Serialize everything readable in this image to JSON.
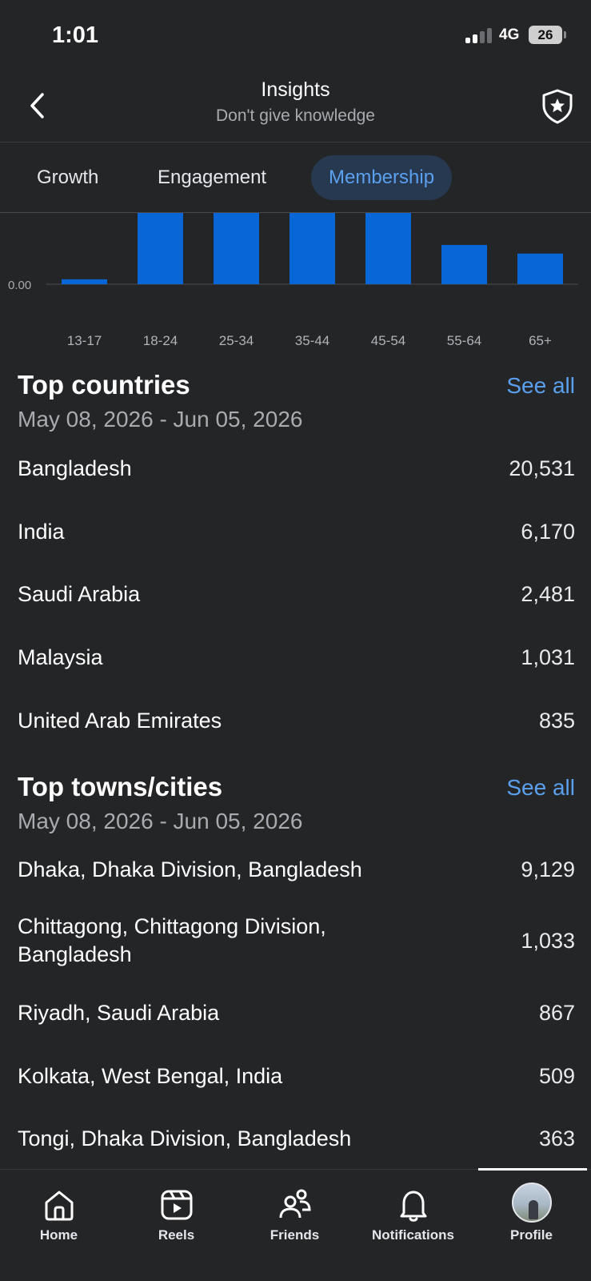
{
  "status_bar": {
    "time": "1:01",
    "network": "4G",
    "battery": "26"
  },
  "header": {
    "title": "Insights",
    "subtitle": "Don't give knowledge"
  },
  "tabs": [
    {
      "label": "Growth",
      "active": false
    },
    {
      "label": "Engagement",
      "active": false
    },
    {
      "label": "Membership",
      "active": true
    }
  ],
  "chart_data": {
    "type": "bar",
    "categories": [
      "13-17",
      "18-24",
      "25-34",
      "35-44",
      "45-54",
      "55-64",
      "65+"
    ],
    "values": [
      0.4,
      6.0,
      7.5,
      7.5,
      7.5,
      3.2,
      2.5
    ],
    "y_tick_labels": [
      "0.00"
    ],
    "ylim": [
      0,
      6.2
    ],
    "color": "#0866d6",
    "clipped_top": true
  },
  "top_countries": {
    "title": "Top countries",
    "see_all": "See all",
    "date_range": "May 08, 2026 - Jun 05, 2026",
    "rows": [
      {
        "label": "Bangladesh",
        "value": "20,531"
      },
      {
        "label": "India",
        "value": "6,170"
      },
      {
        "label": "Saudi Arabia",
        "value": "2,481"
      },
      {
        "label": "Malaysia",
        "value": "1,031"
      },
      {
        "label": "United Arab Emirates",
        "value": "835"
      }
    ]
  },
  "top_cities": {
    "title": "Top towns/cities",
    "see_all": "See all",
    "date_range": "May 08, 2026 - Jun 05, 2026",
    "rows": [
      {
        "label": "Dhaka, Dhaka Division, Bangladesh",
        "value": "9,129"
      },
      {
        "label": "Chittagong, Chittagong Division, Bangladesh",
        "value": "1,033"
      },
      {
        "label": "Riyadh, Saudi Arabia",
        "value": "867"
      },
      {
        "label": "Kolkata, West Bengal, India",
        "value": "509"
      },
      {
        "label": "Tongi, Dhaka Division, Bangladesh",
        "value": "363"
      }
    ]
  },
  "bottom_nav": [
    {
      "label": "Home",
      "icon": "home-icon"
    },
    {
      "label": "Reels",
      "icon": "reels-icon"
    },
    {
      "label": "Friends",
      "icon": "friends-icon"
    },
    {
      "label": "Notifications",
      "icon": "bell-icon"
    },
    {
      "label": "Profile",
      "icon": "avatar",
      "active": true
    }
  ],
  "colors": {
    "accent": "#5ba0ee",
    "bar": "#0866d6",
    "background": "#242527",
    "active_tab_bg": "#263951"
  }
}
